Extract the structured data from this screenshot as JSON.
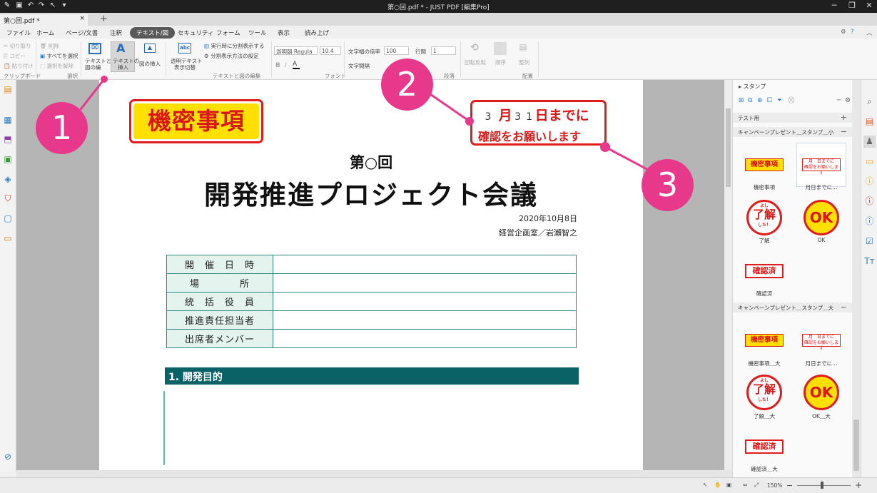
{
  "window": {
    "title": "第○回.pdf * - JUST PDF [編集Pro]"
  },
  "doc_tab": {
    "label": "第○回.pdf *",
    "close": "×",
    "new": "+"
  },
  "menu": [
    "ファイル",
    "ホーム",
    "ページ/文書",
    "注釈",
    "テキスト/図",
    "セキュリティ",
    "フォーム",
    "ツール",
    "表示",
    "読み上げ"
  ],
  "ribbon": {
    "clipboard": {
      "cut": "切り取り",
      "copy": "コピー",
      "paste": "貼り付け",
      "group": "クリップボード"
    },
    "select": {
      "delete": "削除",
      "select_all": "すべてを選択",
      "deselect": "選択を解除",
      "group": "選択"
    },
    "insert": {
      "text_figure_1": "テキストと",
      "text_figure_2": "図の編",
      "text_insert_1": "テキストの",
      "text_insert_2": "挿入",
      "figure_insert": "図の挿入"
    },
    "edit": {
      "transparent_1": "透明テキスト",
      "transparent_2": "表示切替",
      "split_show": "実行時に分割表示する",
      "split_settings": "分割表示方法の設定",
      "group": "テキストと図の編集"
    },
    "font": {
      "name": "游明朝 Regula",
      "size": "10.4",
      "bold": "B",
      "italic": "I",
      "group": "フォント"
    },
    "paragraph": {
      "width_label": "文字幅の倍率",
      "width_value": "100",
      "spacing_label": "文字間隔",
      "line_label": "行間",
      "line_value": "1",
      "group": "段落"
    },
    "arrange": {
      "rotate": "回転反転",
      "order": "順序",
      "align": "整列",
      "group": "配置"
    }
  },
  "document": {
    "stamp_secret": "機密事項",
    "stamp_deadline_line1": {
      "num1": "3",
      "month": "月",
      "num2": "3",
      "num3": "1",
      "rest": "日までに"
    },
    "stamp_deadline_line2": "確認をお願いします",
    "subtitle": "第○回",
    "title": "開発推進プロジェクト会議",
    "date": "2020年10月8日",
    "author": "経営企画室／岩瀬智之",
    "table": [
      "開　催　日　時",
      "場　　　　所",
      "統　括　役　員",
      "推進責任担当者",
      "出席者メンバー"
    ],
    "section": "1. 開発目的"
  },
  "stamp_panel": {
    "title": "スタンプ",
    "row_test": "テスト用",
    "row_small": "キャンペーンプレゼント＿スタンプ＿小",
    "row_large": "キャンペーンプレゼント＿スタンプ＿大",
    "small_items": [
      "機密事項",
      "月日までに...",
      "了解",
      "OK",
      "確認済"
    ],
    "large_items": [
      "機密事項＿大",
      "月日までに...",
      "了解＿大",
      "OK＿大",
      "確認済＿大"
    ],
    "stamp_text": {
      "secret": "機密事項",
      "deadline_l1": "月　日までに",
      "deadline_l2": "確認をお願いします",
      "ok": "OK",
      "confirmed": "確認済",
      "ryoukai": "了解",
      "yoshi": "よし",
      "shita": "した！"
    }
  },
  "status": {
    "zoom": "150%"
  },
  "callouts": [
    "1",
    "2",
    "3"
  ],
  "colors": {
    "accent": "#e8388c",
    "stamp_red": "#e01d1d",
    "stamp_yellow": "#ffe000",
    "section_bg": "#0a6266",
    "table_border": "#2e8a80"
  }
}
